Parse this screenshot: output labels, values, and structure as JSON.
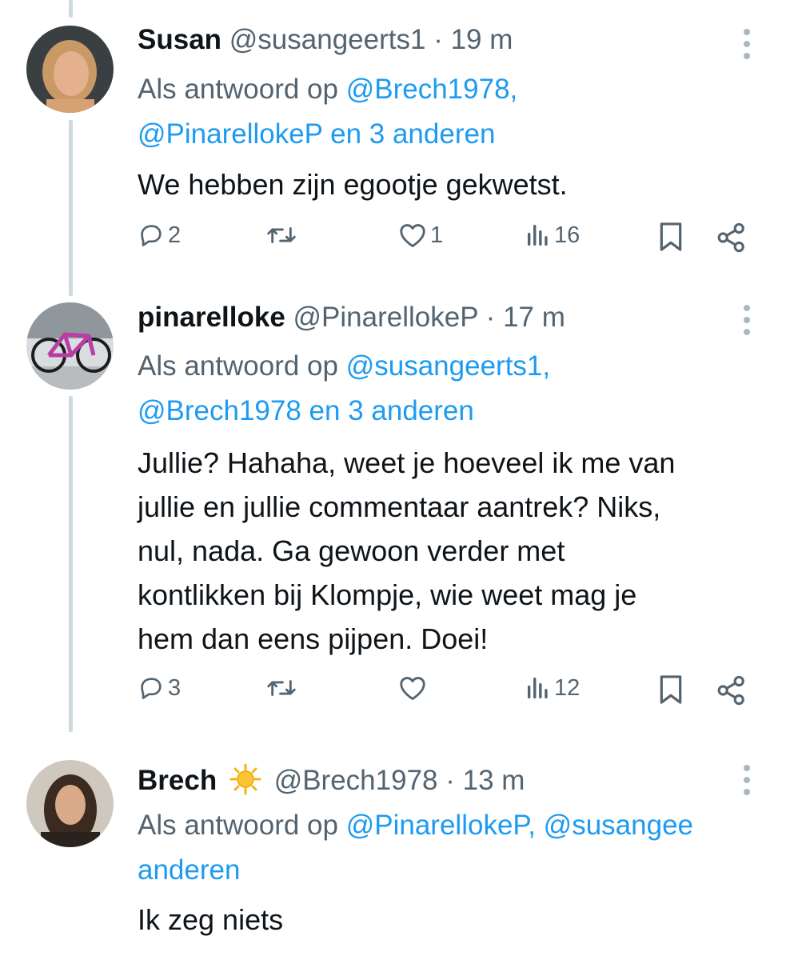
{
  "colors": {
    "link": "#1d9bf0",
    "muted": "#536471",
    "text": "#0f1419",
    "thread": "#cfd9de"
  },
  "tweets": [
    {
      "name": "Susan",
      "emoji": "",
      "handle": "@susangeerts1",
      "dot": "·",
      "time": "19 m",
      "reply_prefix": "Als antwoord op ",
      "reply_links": [
        "@Brech1978,",
        "@PinarellokeP en 3 anderen"
      ],
      "text_lines": [
        "We hebben zijn egootje gekwetst."
      ],
      "replies": "2",
      "retweets": "",
      "likes": "1",
      "views": "16",
      "icons": [
        "reply-icon",
        "retweet-icon",
        "like-icon",
        "views-icon",
        "bookmark-icon",
        "share-icon"
      ]
    },
    {
      "name": "pinarelloke",
      "emoji": "",
      "handle": "@PinarellokeP",
      "dot": "·",
      "time": "17 m",
      "reply_prefix": "Als antwoord op ",
      "reply_links": [
        "@susangeerts1,",
        "@Brech1978 en 3 anderen"
      ],
      "text_lines": [
        "Jullie? Hahaha, weet je hoeveel ik me van",
        "jullie en jullie commentaar aantrek? Niks,",
        "nul, nada. Ga gewoon verder met",
        "kontlikken bij Klompje, wie weet mag je",
        "hem dan eens pijpen. Doei!"
      ],
      "replies": "3",
      "retweets": "",
      "likes": "",
      "views": "12",
      "icons": [
        "reply-icon",
        "retweet-icon",
        "like-icon",
        "views-icon",
        "bookmark-icon",
        "share-icon"
      ]
    },
    {
      "name": "Brech",
      "emoji": "sun-emoji",
      "handle": "@Brech1978",
      "dot": "·",
      "time": "13 m",
      "reply_prefix": "Als antwoord op ",
      "reply_links": [
        "@PinarellokeP, @susangee",
        "anderen"
      ],
      "text_lines": [
        "Ik zeg niets"
      ]
    }
  ]
}
